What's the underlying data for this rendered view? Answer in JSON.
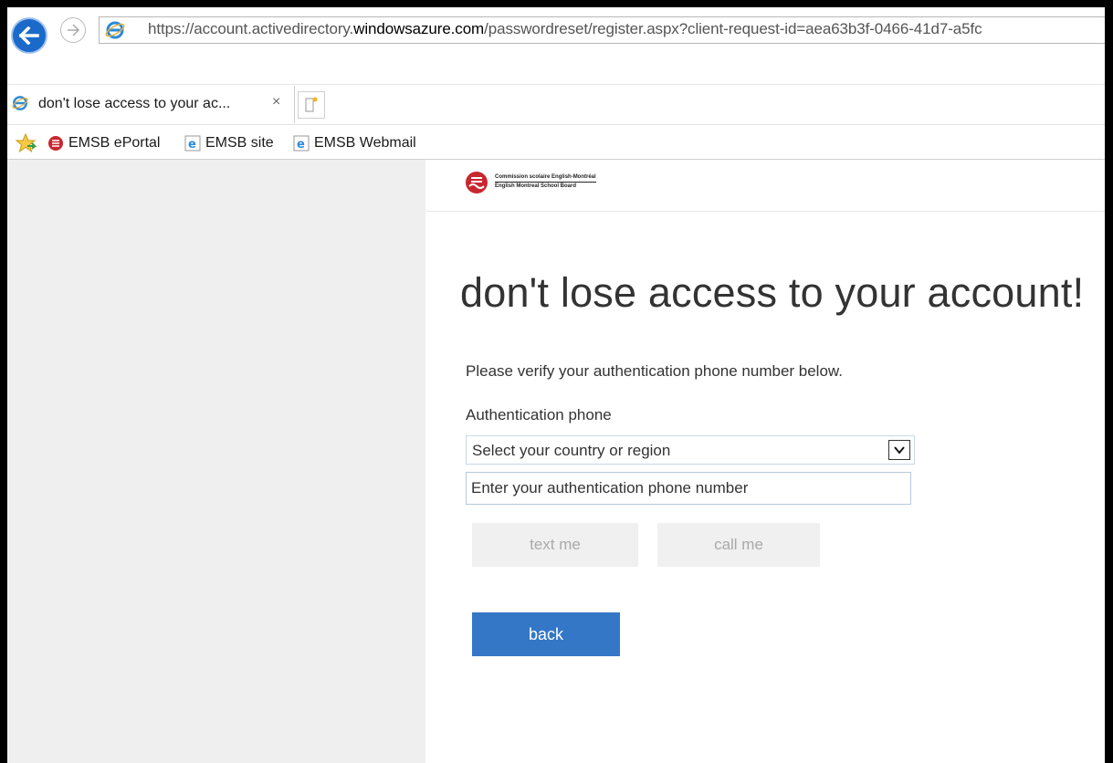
{
  "browser": {
    "url_prefix": "https://account.activedirectory.",
    "url_domain": "windowsazure.com",
    "url_path": "/passwordreset/register.aspx?client-request-id=aea63b3f-0466-41d7-a5fc",
    "back_icon": "back-arrow-icon",
    "forward_icon": "forward-arrow-icon",
    "accent_color": "#1b6ac9"
  },
  "tab": {
    "title": "don't lose access to your ac...",
    "close_label": "×"
  },
  "favorites": {
    "items": [
      {
        "label": "EMSB ePortal",
        "icon": "emsb-portal-icon"
      },
      {
        "label": "EMSB site",
        "icon": "ie-page-icon"
      },
      {
        "label": "EMSB Webmail",
        "icon": "ie-page-icon"
      }
    ]
  },
  "page": {
    "logo": {
      "line1": "Commission scolaire English-Montréal",
      "line2": "English Montreal School Board"
    },
    "heading": "don't lose access to your account!",
    "instruction": "Please verify your authentication phone number below.",
    "phone_label": "Authentication phone",
    "country_select": "Select your country or region",
    "phone_placeholder": "Enter your authentication phone number",
    "text_button": "text me",
    "call_button": "call me",
    "back_button": "back",
    "primary_color": "#3477c7"
  }
}
